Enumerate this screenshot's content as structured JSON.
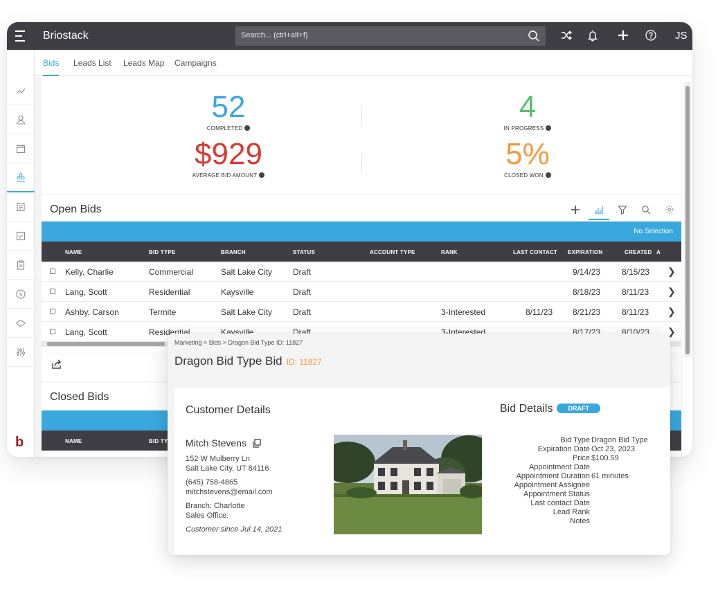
{
  "app": {
    "brand": "Briostack",
    "search_placeholder": "Search... (ctrl+alt+f)",
    "user_initials": "JS",
    "sidebar_logo": "b"
  },
  "tabs": [
    {
      "label": "Bids",
      "active": true
    },
    {
      "label": "Leads List",
      "active": false
    },
    {
      "label": "Leads Map",
      "active": false
    },
    {
      "label": "Campaigns",
      "active": false
    }
  ],
  "sidebar_icons": [
    "analytics-icon",
    "user-icon",
    "calendar-icon",
    "sales-icon",
    "invoice-icon",
    "checklist-icon",
    "clipboard-icon",
    "dollar-icon",
    "tag-icon",
    "settings-sliders-icon"
  ],
  "stats": {
    "completed": {
      "value": "52",
      "label": "COMPLETED",
      "color": "#3aa8de"
    },
    "in_progress": {
      "value": "4",
      "label": "IN PROGRESS",
      "color": "#5cbf6a"
    },
    "avg_bid": {
      "value": "$929",
      "label": "AVERAGE BID AMOUNT",
      "color": "#d73b34"
    },
    "closed_won": {
      "value": "5%",
      "label": "CLOSED WON",
      "color": "#f39a3d"
    }
  },
  "open_bids": {
    "title": "Open Bids",
    "selection_text": "No Selection",
    "columns": [
      "NAME",
      "BID TYPE",
      "BRANCH",
      "STATUS",
      "ACCOUNT TYPE",
      "RANK",
      "LAST CONTACT",
      "EXPIRATION",
      "CREATED",
      "A"
    ],
    "rows": [
      {
        "name": "Kelly, Charlie",
        "bid_type": "Commercial",
        "branch": "Salt Lake City",
        "status": "Draft",
        "account_type": "",
        "rank": "",
        "last_contact": "",
        "expiration": "9/14/23",
        "created": "8/15/23"
      },
      {
        "name": "Lang, Scott",
        "bid_type": "Residential",
        "branch": "Kaysville",
        "status": "Draft",
        "account_type": "",
        "rank": "",
        "last_contact": "",
        "expiration": "8/18/23",
        "created": "8/11/23"
      },
      {
        "name": "Ashby, Carson",
        "bid_type": "Termite",
        "branch": "Salt Lake City",
        "status": "Draft",
        "account_type": "",
        "rank": "3-Interested",
        "last_contact": "8/11/23",
        "expiration": "8/21/23",
        "created": "8/11/23"
      },
      {
        "name": "Lang, Scott",
        "bid_type": "Residential",
        "branch": "Kaysville",
        "status": "Draft",
        "account_type": "",
        "rank": "3-Interested",
        "last_contact": "",
        "expiration": "8/17/23",
        "created": "8/10/23"
      }
    ]
  },
  "closed_bids": {
    "title": "Closed Bids",
    "columns": [
      "NAME",
      "BID TY"
    ]
  },
  "detail": {
    "breadcrumb": "Marketing > Bids > Dragon Bid Type ID: 11827",
    "title": "Dragon Bid Type Bid",
    "id_label": "ID: 11827",
    "customer_section": "Customer Details",
    "customer": {
      "name": "Mitch Stevens",
      "address1": "152 W Mulberry Ln",
      "address2": "Salt Lake City, UT 84116",
      "phone": "(645) 758-4865",
      "email": "mitchstevens@email.com",
      "branch": "Branch: Charlotte",
      "sales_office": "Sales Office:",
      "since": "Customer since Jul 14, 2021"
    },
    "bid_section": "Bid Details",
    "bid_status": "DRAFT",
    "bid_fields": [
      {
        "label": "Bid Type",
        "value": "Dragon Bid Type"
      },
      {
        "label": "Expiration Date",
        "value": "Oct 23, 2023"
      },
      {
        "label": "Price",
        "value": "$100.59"
      },
      {
        "label": "Appointment Date",
        "value": ""
      },
      {
        "label": "Appointment Duration",
        "value": "61 minutes"
      },
      {
        "label": "Appointment Assignee",
        "value": ""
      },
      {
        "label": "Appointment Status",
        "value": ""
      },
      {
        "label": "Last contact Date",
        "value": ""
      },
      {
        "label": "Lead Rank",
        "value": ""
      },
      {
        "label": "Notes",
        "value": ""
      }
    ]
  }
}
